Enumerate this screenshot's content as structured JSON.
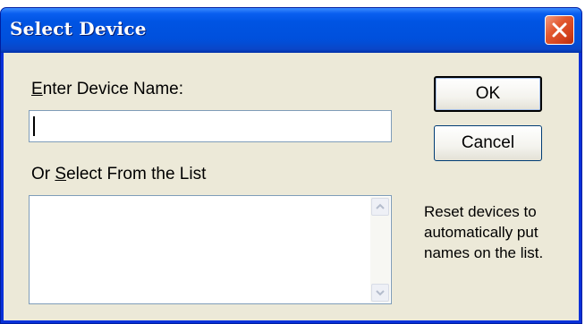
{
  "window": {
    "title": "Select Device"
  },
  "name_section": {
    "label_accel": "E",
    "label_rest": "nter Device Name:",
    "input_value": ""
  },
  "list_section": {
    "label_prefix": "Or ",
    "label_accel": "S",
    "label_rest": "elect From the List",
    "items": []
  },
  "buttons": {
    "ok": "OK",
    "cancel": "Cancel"
  },
  "hint": "Reset devices to automatically put names on the list.",
  "icons": {
    "close": "close-icon",
    "scroll_up": "chevron-up-icon",
    "scroll_down": "chevron-down-icon"
  },
  "colors": {
    "titlebar": "#0054e3",
    "close_button": "#d2401c",
    "dialog_face": "#ece9d8",
    "field_border": "#7f9db9"
  }
}
